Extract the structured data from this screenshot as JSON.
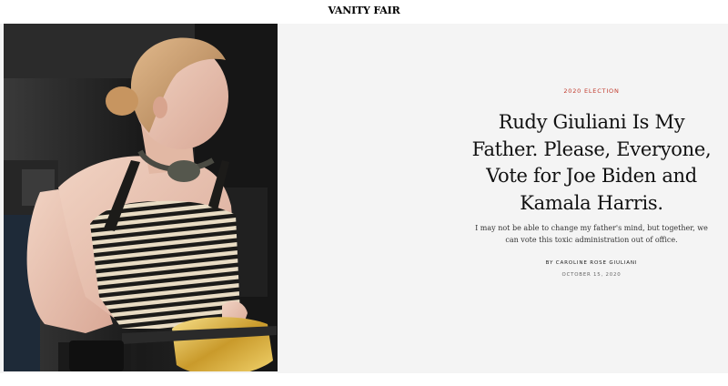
{
  "header": {
    "logo_text": "VANITY FAIR"
  },
  "article": {
    "kicker": "2020 ELECTION",
    "headline": "Rudy Giuliani Is My Father. Please, Everyone, Vote for Joe Biden and Kamala Harris.",
    "dek": "I may not be able to change my father's mind, but together, we can vote this toxic administration out of office.",
    "byline": "BY CAROLINE ROSE GIULIANI",
    "date": "OCTOBER 15, 2020"
  },
  "colors": {
    "kicker": "#c0392b",
    "hero_background": "#f4f4f4",
    "text": "#111111"
  },
  "photo": {
    "subject": "woman in striped tank top with headphones around neck and gold fanny pack"
  }
}
